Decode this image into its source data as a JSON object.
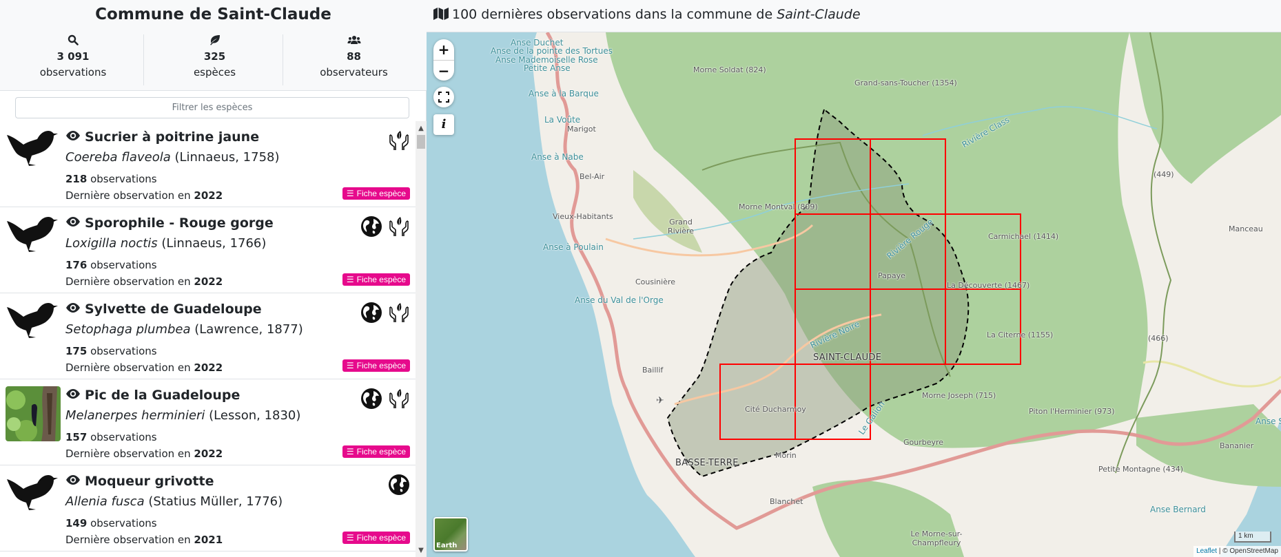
{
  "commune": {
    "title": "Commune de Saint-Claude",
    "stats": [
      {
        "icon": "search-icon",
        "value": "3 091",
        "label": "observations"
      },
      {
        "icon": "leaf-icon",
        "value": "325",
        "label": "espèces"
      },
      {
        "icon": "users-icon",
        "value": "88",
        "label": "observateurs"
      }
    ],
    "filter_placeholder": "Filtrer les espèces"
  },
  "species": [
    {
      "vernacular": "Sucrier à poitrine jaune",
      "scientific": "Coereba flaveola",
      "author": " (Linnaeus, 1758)",
      "count": "218",
      "count_label": " observations",
      "last_label": "Dernière observation en ",
      "last_year": "2022",
      "thumb": "bird-silhouette",
      "badges": [
        "protected-icon"
      ],
      "fiche_label": "Fiche espèce"
    },
    {
      "vernacular": "Sporophile - Rouge gorge",
      "scientific": "Loxigilla noctis",
      "author": " (Linnaeus, 1766)",
      "count": "176",
      "count_label": " observations",
      "last_label": "Dernière observation en ",
      "last_year": "2022",
      "thumb": "bird-silhouette",
      "badges": [
        "endemic-globe-icon",
        "protected-icon"
      ],
      "fiche_label": "Fiche espèce"
    },
    {
      "vernacular": "Sylvette de Guadeloupe",
      "scientific": "Setophaga plumbea",
      "author": " (Lawrence, 1877)",
      "count": "175",
      "count_label": " observations",
      "last_label": "Dernière observation en ",
      "last_year": "2022",
      "thumb": "bird-silhouette",
      "badges": [
        "endemic-globe-icon",
        "protected-icon"
      ],
      "fiche_label": "Fiche espèce"
    },
    {
      "vernacular": "Pic de la Guadeloupe",
      "scientific": "Melanerpes herminieri",
      "author": " (Lesson, 1830)",
      "count": "157",
      "count_label": " observations",
      "last_label": "Dernière observation en ",
      "last_year": "2022",
      "thumb": "photo",
      "badges": [
        "endemic-globe-icon",
        "protected-icon"
      ],
      "fiche_label": "Fiche espèce"
    },
    {
      "vernacular": "Moqueur grivotte",
      "scientific": "Allenia fusca",
      "author": " (Statius Müller, 1776)",
      "count": "149",
      "count_label": " observations",
      "last_label": "Dernière observation en ",
      "last_year": "2021",
      "thumb": "bird-silhouette",
      "badges": [
        "endemic-globe-icon"
      ],
      "fiche_label": "Fiche espèce"
    }
  ],
  "map": {
    "title_prefix": "100 dernières observations dans la commune de ",
    "title_commune": "Saint-Claude",
    "zoom_in": "+",
    "zoom_out": "−",
    "info": "i",
    "layer_label": "Earth",
    "scale": "1 km",
    "attribution_leaflet": "Leaflet",
    "attribution_rest": " | © OpenStreetMap",
    "colors": {
      "grid": "#ff0000",
      "sea": "#aad3df",
      "forest": "#add19e",
      "commune_fill": "#8a9a7a"
    },
    "labels": {
      "anse_duchet": "Anse Duchet",
      "anse_tortues": "Anse de la pointe des Tortues",
      "anse_mlle_rose": "Anse Mademoiselle Rose",
      "petite_anse": "Petite Anse",
      "anse_barque": "Anse à la Barque",
      "la_voute": "La Voûte",
      "marigot": "Marigot",
      "anse_nabe": "Anse à Nabe",
      "bel_air": "Bel-Air",
      "vieux_habitants": "Vieux-Habitants",
      "grand_riviere": "Grand Rivière",
      "anse_poulain": "Anse à Poulain",
      "cousiniere": "Cousinière",
      "anse_val_orge": "Anse du Val de l'Orge",
      "baillif": "Baillif",
      "basse_terre": "BASSE-TERRE",
      "saint_claude": "SAINT-CLAUDE",
      "cite_ducharmoy": "Cité Ducharmoy",
      "morin": "Morin",
      "blanchet": "Blanchet",
      "gourbeyre": "Gourbeyre",
      "morne_champfleury": "Le Morne-sur-Champfleury",
      "morne_soldat": "Morne Soldat (824)",
      "grand_sans_toucher": "Grand-sans-Toucher (1354)",
      "morne_montval": "Morne Montval (809)",
      "riviere_class": "Rivière Class",
      "riviere_rouge": "Rivière Rouge",
      "riviere_noire": "Rivière Noire",
      "le_galion": "Le Galion",
      "papaye": "Papaye",
      "carmichael": "Carmichael (1414)",
      "la_decouverte": "La Découverte (1467)",
      "la_citerne": "La Citerne (1155)",
      "morne_joseph": "Morne Joseph (715)",
      "piton_herminier": "Piton l'Herminier (973)",
      "petite_montagne": "Petite Montagne (434)",
      "bananier": "Bananier",
      "anse_bernard": "Anse Bernard",
      "anse_sa": "Anse Sa",
      "manceau": "Manceau",
      "peak_449": "(449)",
      "peak_466": "(466)"
    }
  }
}
